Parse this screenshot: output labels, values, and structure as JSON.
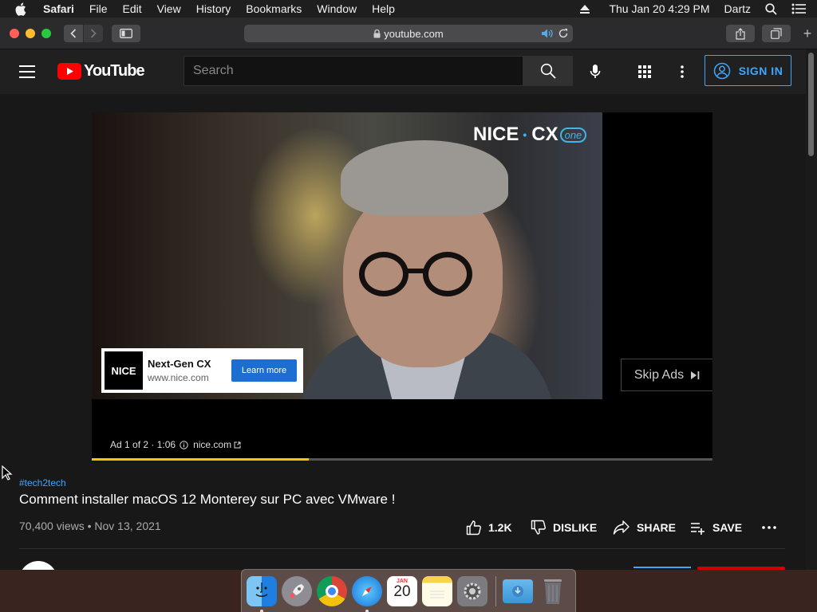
{
  "menubar": {
    "app": "Safari",
    "items": [
      "File",
      "Edit",
      "View",
      "History",
      "Bookmarks",
      "Window",
      "Help"
    ],
    "clock": "Thu Jan 20  4:29 PM",
    "user": "Dartz"
  },
  "safari": {
    "url": "youtube.com"
  },
  "youtube": {
    "logo_text": "YouTube",
    "search_placeholder": "Search",
    "sign_in_label": "SIGN IN"
  },
  "ad": {
    "brand_nice": "NICE",
    "brand_cx": "CX",
    "brand_one": "one",
    "card_logo": "NICE",
    "card_title": "Next-Gen CX",
    "card_url": "www.nice.com",
    "cta_label": "Learn more",
    "skip_label": "Skip Ads",
    "counter": "Ad 1 of 2 · 1:06",
    "domain": "nice.com",
    "progress": 0.35
  },
  "video": {
    "hashtag": "#tech2tech",
    "title": "Comment installer macOS 12 Monterey sur PC avec VMware !",
    "meta": "70,400 views • Nov 13, 2021",
    "likes": "1.2K",
    "dislike_label": "DISLIKE",
    "share_label": "SHARE",
    "save_label": "SAVE"
  },
  "dock": {
    "calendar_month": "JAN",
    "calendar_day": "20"
  },
  "colors": {
    "youtube_red": "#ff0000",
    "link_blue": "#3ea6ff",
    "ad_progress": "#f7c600"
  }
}
